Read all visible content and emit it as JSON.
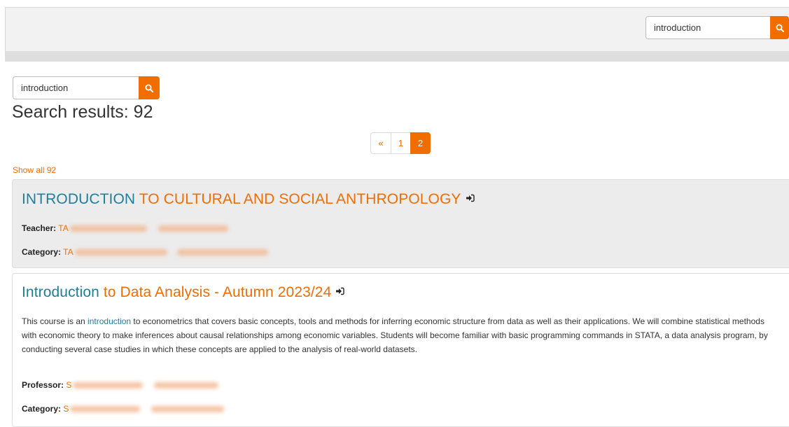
{
  "header": {
    "search": {
      "value": "introduction"
    },
    "icons": {
      "search": "search-icon"
    }
  },
  "search": {
    "value": "introduction",
    "results_label": "Search results: 92"
  },
  "pagination": {
    "prev": "«",
    "pages": [
      "1",
      "2"
    ],
    "current": "2"
  },
  "show_all": "Show all 92",
  "colors": {
    "accent": "#f26d00",
    "keyword": "#1e7f9a"
  },
  "results": [
    {
      "title_keyword": "INTRODUCTION",
      "title_rest": " TO CULTURAL AND SOCIAL ANTHROPOLOGY",
      "icon": "enter-icon",
      "meta": [
        {
          "label": "Teacher:",
          "value": "TA"
        },
        {
          "label": "Category:",
          "value": "TA"
        }
      ]
    },
    {
      "title_keyword": "Introduction",
      "title_rest": " to Data Analysis - Autumn 2023/24",
      "icon": "enter-icon",
      "description_before": "This course is an ",
      "description_keyword": "introduction",
      "description_after": " to econometrics that covers basic concepts, tools and methods for inferring economic structure from data as well as their applications. We will combine statistical methods with economic theory to make inferences about causal relationships among economic variables. Students will become familiar with basic programming commands in STATA, a data analysis program, by conducting several case studies in which these concepts are applied to the analysis of real-world datasets.",
      "meta": [
        {
          "label": "Professor:",
          "value": "S"
        },
        {
          "label": "Category:",
          "value": "S"
        }
      ]
    }
  ]
}
